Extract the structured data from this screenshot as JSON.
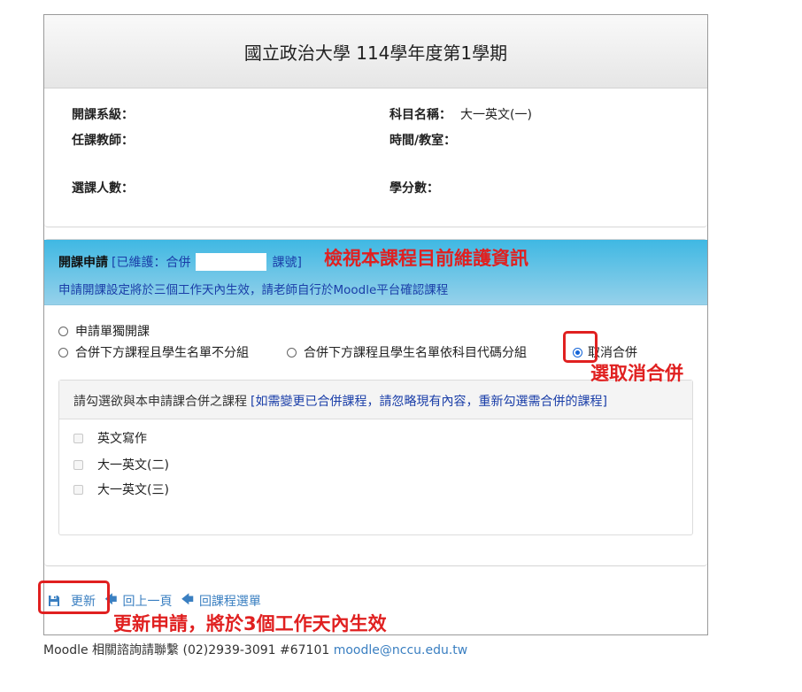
{
  "header": {
    "title": "國立政治大學 114學年度第1學期"
  },
  "course_info": {
    "department_label": "開課系級：",
    "course_name_label": "科目名稱：",
    "course_name_value": "大一英文(一)",
    "teacher_label": "任課教師：",
    "time_room_label": "時間/教室：",
    "enrollment_label": "選課人數：",
    "credits_label": "學分數："
  },
  "apply": {
    "title": "開課申請",
    "maintained_prefix": "[已維護：合併",
    "maintained_suffix": "課號]",
    "notice": "申請開課設定將於三個工作天內生效，請老師自行於Moodle平台確認課程",
    "options": [
      {
        "label": "申請單獨開課",
        "checked": false
      },
      {
        "label": "合併下方課程且學生名單不分組",
        "checked": false
      },
      {
        "label": "合併下方課程且學生名單依科目代碼分組",
        "checked": false
      },
      {
        "label": "取消合併",
        "checked": true
      }
    ]
  },
  "merge": {
    "heading": "請勾選欲與本申請課合併之課程",
    "hint": "[如需變更已合併課程，請忽略現有內容，重新勾選需合併的課程]",
    "courses": [
      "英文寫作",
      "大一英文(二)",
      "大一英文(三)"
    ]
  },
  "actions": {
    "update_label": "更新",
    "back_label": "回上一頁",
    "menu_label": "回課程選單"
  },
  "annotations": {
    "view_info": "檢視本課程目前維護資訊",
    "select_cancel": "選取消合併",
    "update_note": "更新申請，將於3個工作天內生效"
  },
  "footer": {
    "text": "Moodle 相關諮詢請聯繫 (02)2939-3091 #67101",
    "email": "moodle@nccu.edu.tw"
  },
  "colors": {
    "accent_blue": "#3fb8e3",
    "link": "#3a7fc1",
    "annotation_red": "#e02020",
    "radio_selected": "#1565d8"
  }
}
